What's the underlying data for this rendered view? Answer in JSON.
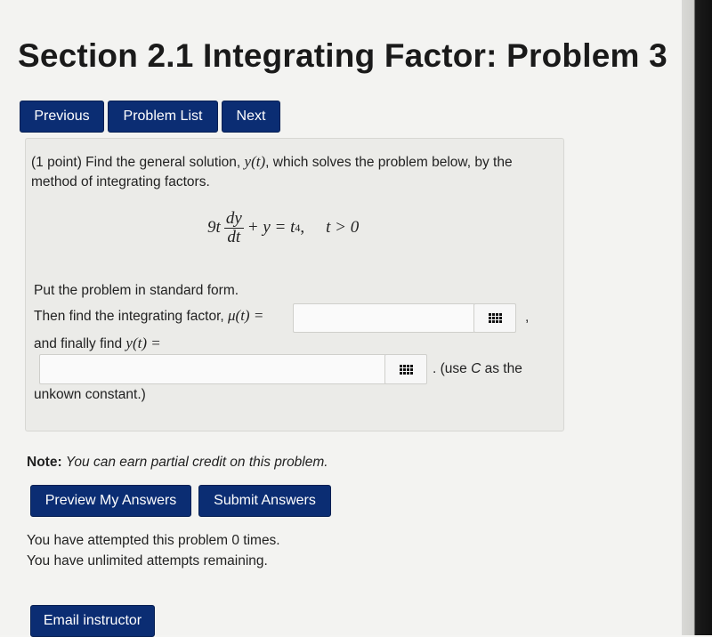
{
  "page_title": "Section 2.1 Integrating Factor: Problem 3",
  "nav": {
    "previous_label": "Previous",
    "problem_list_label": "Problem List",
    "next_label": "Next"
  },
  "problem": {
    "line1_prefix": "(1 point) Find the general solution,",
    "line1_func": "y(t)",
    "line1_suffix": ", which solves the problem below, by the",
    "line2": "method of integrating factors.",
    "equation": {
      "coef": "9t",
      "num": "dy",
      "den": "dt",
      "rhs": "+ y = t",
      "exp": "4",
      "comma": ",",
      "condition": "t > 0"
    },
    "standard_form_text": "Put the problem in standard form.",
    "integrating_factor_text": "Then find the integrating factor,",
    "mu": "μ(t) =",
    "after_mu": ",",
    "finally_text": "and finally find",
    "y_eq": "y(t) =",
    "use_c_prefix": ". (use",
    "use_c_var": "C",
    "use_c_suffix": "as the",
    "unknown_constant": "unkown constant.)"
  },
  "note": {
    "label": "Note:",
    "text": "You can earn partial credit on this problem."
  },
  "actions": {
    "preview_label": "Preview My Answers",
    "submit_label": "Submit Answers"
  },
  "attempts": {
    "line1": "You have attempted this problem 0 times.",
    "line2": "You have unlimited attempts remaining."
  },
  "email_label": "Email instructor",
  "icons": {
    "palette": "equation-editor-grid-icon"
  }
}
